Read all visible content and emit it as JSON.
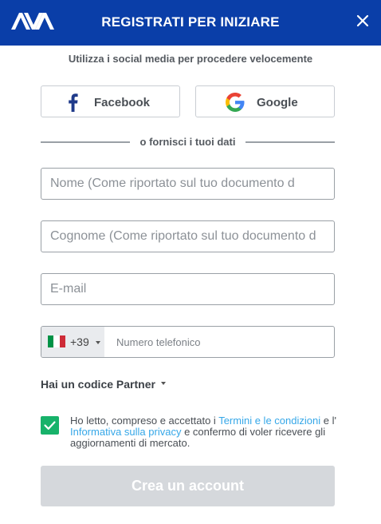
{
  "colors": {
    "header_bg": "#0a3ea8",
    "checkbox": "#17b26a",
    "link": "#35a7e8",
    "button_disabled": "#d5d8dc"
  },
  "header": {
    "logo_text": "AVA",
    "title": "REGISTRATI PER INIZIARE",
    "close_icon": "close-icon"
  },
  "social": {
    "intro": "Utilizza i social media per procedere velocemente",
    "facebook_label": "Facebook",
    "google_label": "Google"
  },
  "divider": {
    "text": "o fornisci i tuoi dati"
  },
  "form": {
    "name_placeholder": "Nome (Come riportato sul tuo documento d",
    "surname_placeholder": "Cognome (Come riportato sul tuo documento d",
    "email_placeholder": "E-mail",
    "phone": {
      "country_code": "+39",
      "country_flag": "italy-flag",
      "placeholder": "Numero telefonico"
    },
    "partner_label": "Hai un codice Partner"
  },
  "terms": {
    "checked": true,
    "text_1": "Ho letto, compreso e accettato i ",
    "link_1": "Termini e le condizioni",
    "text_2": " e l' ",
    "link_2": "Informativa sulla privacy",
    "text_3": " e confermo di voler ricevere gli aggiornamenti di mercato."
  },
  "submit": {
    "label": "Crea un account"
  }
}
